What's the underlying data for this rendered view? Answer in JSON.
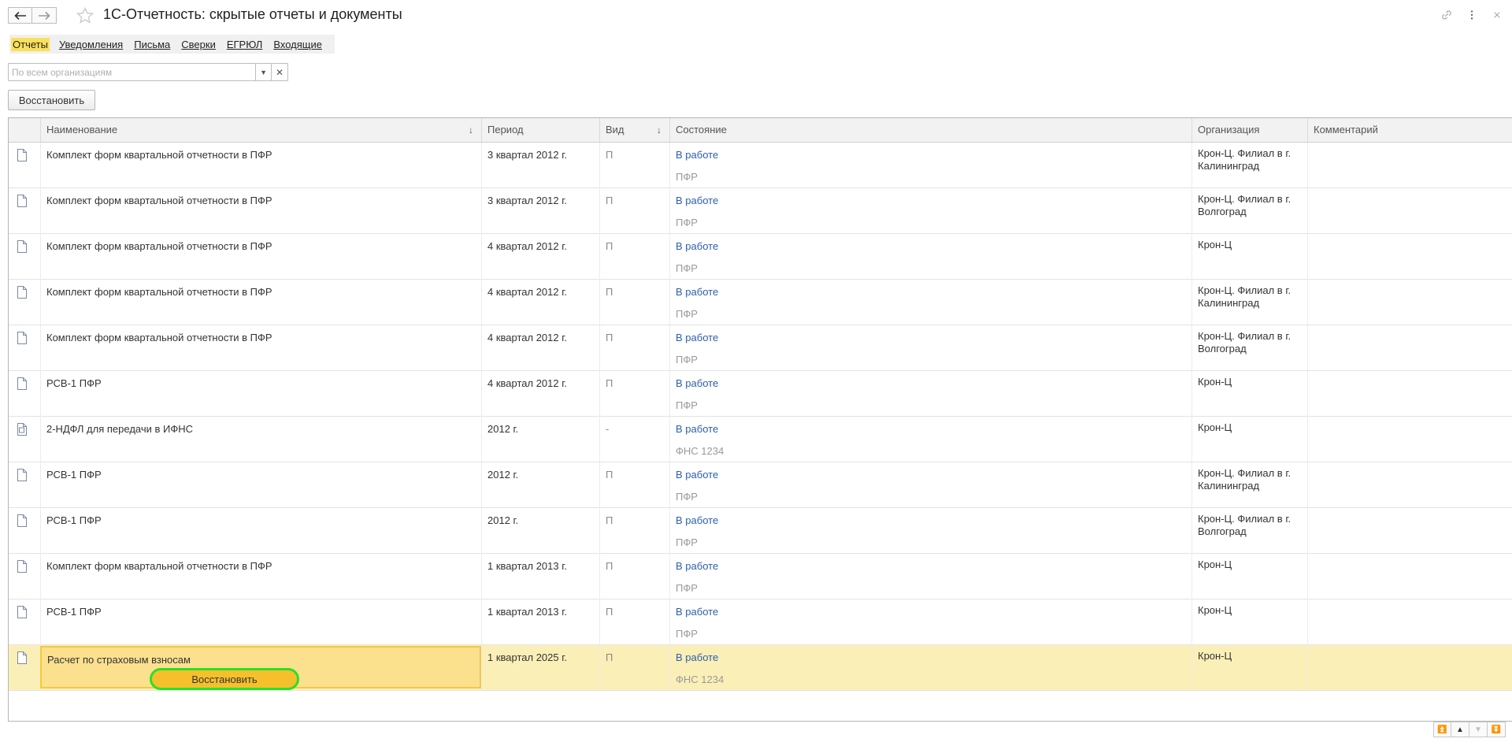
{
  "window": {
    "title": "1С-Отчетность: скрытые отчеты и документы"
  },
  "tabs": [
    {
      "label": "Отчеты",
      "active": true
    },
    {
      "label": "Уведомления",
      "active": false
    },
    {
      "label": "Письма",
      "active": false
    },
    {
      "label": "Сверки",
      "active": false
    },
    {
      "label": "ЕГРЮЛ",
      "active": false
    },
    {
      "label": "Входящие",
      "active": false
    }
  ],
  "filter": {
    "placeholder": "По всем организациям",
    "value": ""
  },
  "toolbar": {
    "restore_label": "Восстановить"
  },
  "table": {
    "columns": {
      "name": "Наименование",
      "period": "Период",
      "kind": "Вид",
      "state": "Состояние",
      "org": "Организация",
      "comment": "Комментарий"
    },
    "rows": [
      {
        "name": "Комплект форм квартальной отчетности в ПФР",
        "period": "3 квартал 2012 г.",
        "kind": "П",
        "state": "В работе",
        "recipient": "ПФР",
        "org": "Крон-Ц. Филиал в г. Калининград",
        "comment": ""
      },
      {
        "name": "Комплект форм квартальной отчетности в ПФР",
        "period": "3 квартал 2012 г.",
        "kind": "П",
        "state": "В работе",
        "recipient": "ПФР",
        "org": "Крон-Ц. Филиал в г. Волгоград",
        "comment": ""
      },
      {
        "name": "Комплект форм квартальной отчетности в ПФР",
        "period": "4 квартал 2012 г.",
        "kind": "П",
        "state": "В работе",
        "recipient": "ПФР",
        "org": "Крон-Ц",
        "comment": ""
      },
      {
        "name": "Комплект форм квартальной отчетности в ПФР",
        "period": "4 квартал 2012 г.",
        "kind": "П",
        "state": "В работе",
        "recipient": "ПФР",
        "org": "Крон-Ц. Филиал в г. Калининград",
        "comment": ""
      },
      {
        "name": "Комплект форм квартальной отчетности в ПФР",
        "period": "4 квартал 2012 г.",
        "kind": "П",
        "state": "В работе",
        "recipient": "ПФР",
        "org": "Крон-Ц. Филиал в г. Волгоград",
        "comment": ""
      },
      {
        "name": "РСВ-1 ПФР",
        "period": "4 квартал 2012 г.",
        "kind": "П",
        "state": "В работе",
        "recipient": "ПФР",
        "org": "Крон-Ц",
        "comment": ""
      },
      {
        "name": "2-НДФЛ для передачи в ИФНС",
        "period": "2012 г.",
        "kind": "-",
        "state": "В работе",
        "recipient": "ФНС 1234",
        "org": "Крон-Ц",
        "comment": ""
      },
      {
        "name": "РСВ-1 ПФР",
        "period": "2012 г.",
        "kind": "П",
        "state": "В работе",
        "recipient": "ПФР",
        "org": "Крон-Ц. Филиал в г. Калининград",
        "comment": ""
      },
      {
        "name": "РСВ-1 ПФР",
        "period": "2012 г.",
        "kind": "П",
        "state": "В работе",
        "recipient": "ПФР",
        "org": "Крон-Ц. Филиал в г. Волгоград",
        "comment": ""
      },
      {
        "name": "Комплект форм квартальной отчетности в ПФР",
        "period": "1 квартал 2013 г.",
        "kind": "П",
        "state": "В работе",
        "recipient": "ПФР",
        "org": "Крон-Ц",
        "comment": ""
      },
      {
        "name": "РСВ-1 ПФР",
        "period": "1 квартал 2013 г.",
        "kind": "П",
        "state": "В работе",
        "recipient": "ПФР",
        "org": "Крон-Ц",
        "comment": ""
      },
      {
        "name": "Расчет по страховым взносам",
        "period": "1 квартал 2025 г.",
        "kind": "П",
        "state": "В работе",
        "recipient": "ФНС 1234",
        "org": "Крон-Ц",
        "comment": "",
        "selected": true,
        "row_action": "Восстановить"
      }
    ]
  },
  "icons": {
    "back": "arrow-left-icon",
    "forward": "arrow-right-icon",
    "favorite": "star-icon",
    "link": "link-icon",
    "more": "more-vertical-icon",
    "close": "close-icon",
    "document": "document-icon",
    "document_special": "document-badge-icon"
  },
  "colors": {
    "accent_yellow": "#fbe05a",
    "selected_row": "#fbefb8",
    "link_blue": "#2c5fad",
    "highlight_green": "#29e02a",
    "button_yellow": "#f5c02b"
  }
}
